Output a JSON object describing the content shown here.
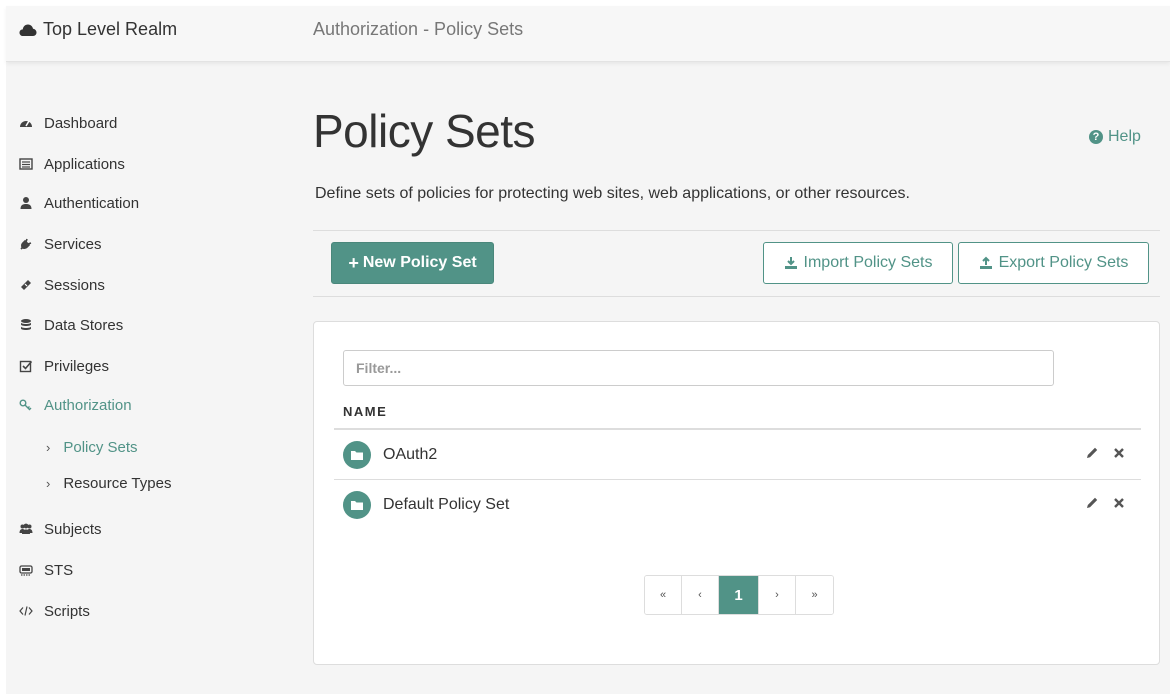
{
  "header": {
    "realm": "Top Level Realm",
    "breadcrumb": "Authorization - Policy Sets"
  },
  "sidebar": {
    "items": [
      {
        "label": "Dashboard",
        "icon": "dashboard-icon"
      },
      {
        "label": "Applications",
        "icon": "applications-icon"
      },
      {
        "label": "Authentication",
        "icon": "user-icon"
      },
      {
        "label": "Services",
        "icon": "plug-icon"
      },
      {
        "label": "Sessions",
        "icon": "ticket-icon"
      },
      {
        "label": "Data Stores",
        "icon": "database-icon"
      },
      {
        "label": "Privileges",
        "icon": "checkbox-icon"
      },
      {
        "label": "Authorization",
        "icon": "key-icon",
        "active": true
      },
      {
        "label": "Subjects",
        "icon": "users-icon"
      },
      {
        "label": "STS",
        "icon": "sts-icon"
      },
      {
        "label": "Scripts",
        "icon": "code-icon"
      }
    ],
    "subitems": [
      {
        "label": "Policy Sets",
        "active": true
      },
      {
        "label": "Resource Types"
      }
    ]
  },
  "main": {
    "title": "Policy Sets",
    "help_label": "Help",
    "description": "Define sets of policies for protecting web sites, web applications, or other resources.",
    "new_button": "New Policy Set",
    "import_button": "Import Policy Sets",
    "export_button": "Export Policy Sets"
  },
  "table": {
    "filter_placeholder": "Filter...",
    "column_name": "NAME",
    "rows": [
      {
        "name": "OAuth2"
      },
      {
        "name": "Default Policy Set"
      }
    ]
  },
  "pagination": {
    "first": "«",
    "prev": "‹",
    "current": "1",
    "next": "›",
    "last": "»"
  },
  "colors": {
    "accent": "#519387",
    "text": "#333333",
    "border": "#dddddd"
  }
}
